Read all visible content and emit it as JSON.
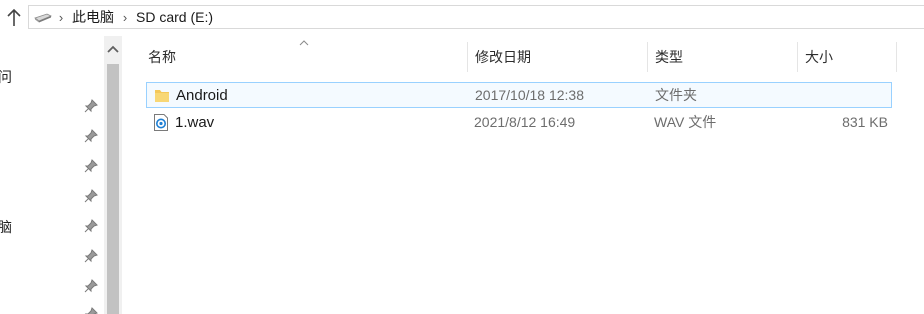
{
  "address_bar": {
    "crumbs": [
      "此电脑",
      "SD card (E:)"
    ]
  },
  "nav_pane": {
    "partial_items": [
      "问",
      "脑"
    ]
  },
  "columns": {
    "name": "名称",
    "modified": "修改日期",
    "type": "类型",
    "size": "大小"
  },
  "files": [
    {
      "name": "Android",
      "modified": "2017/10/18 12:38",
      "type": "文件夹",
      "size": "",
      "icon": "folder-icon"
    },
    {
      "name": "1.wav",
      "modified": "2021/8/12 16:49",
      "type": "WAV 文件",
      "size": "831 KB",
      "icon": "audio-file-icon"
    }
  ],
  "colors": {
    "selection_border": "#99d1ff",
    "selection_fill": "#f4faff",
    "folder": "#f4c85a",
    "audio": "#1e7fd4"
  }
}
